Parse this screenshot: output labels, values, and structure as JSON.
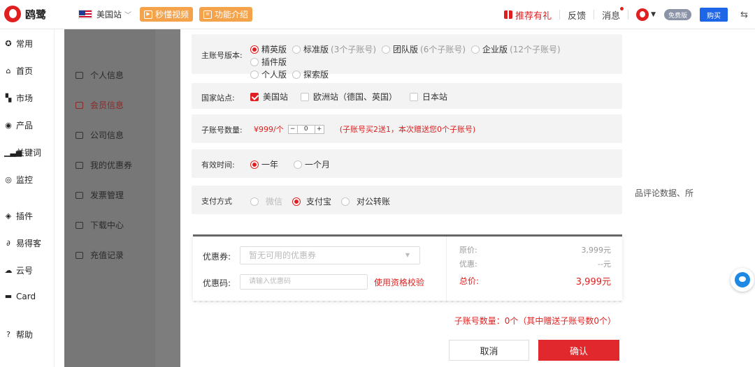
{
  "brand": {
    "name": "鸥鹭",
    "color": "#e02020"
  },
  "topbar": {
    "site": "美国站",
    "video_btn": "秒懂视频",
    "intro_btn": "功能介绍",
    "gift": "推荐有礼",
    "feedback": "反馈",
    "message": "消息",
    "plan_badge": "免费版",
    "buy": "购买"
  },
  "sidebar": {
    "items": [
      {
        "label": "常用",
        "icon": "star-icon"
      },
      {
        "label": "首页",
        "icon": "home-icon"
      },
      {
        "label": "市场",
        "icon": "market-icon"
      },
      {
        "label": "产品",
        "icon": "product-icon"
      },
      {
        "label": "关键词",
        "icon": "keyword-icon"
      },
      {
        "label": "监控",
        "icon": "monitor-icon"
      },
      {
        "label": "插件",
        "icon": "plugin-icon"
      },
      {
        "label": "易得客",
        "icon": "link-icon"
      },
      {
        "label": "云号",
        "icon": "cloud-icon"
      },
      {
        "label": "Card",
        "icon": "card-icon"
      },
      {
        "label": "帮助",
        "icon": "help-icon"
      }
    ]
  },
  "behind_menu": {
    "items": [
      "个人信息",
      "会员信息",
      "公司信息",
      "我的优惠券",
      "发票管理",
      "下载中心",
      "充值记录"
    ],
    "active_index": 1,
    "right_text": "品评论数据、所"
  },
  "modal": {
    "version": {
      "label": "主账号版本:",
      "options": [
        {
          "name": "精英版",
          "sub": "",
          "selected": true
        },
        {
          "name": "标准版",
          "sub": "(3个子账号)",
          "selected": false
        },
        {
          "name": "团队版",
          "sub": "(6个子账号)",
          "selected": false
        },
        {
          "name": "企业版",
          "sub": "(12个子账号)",
          "selected": false
        },
        {
          "name": "插件版",
          "sub": "",
          "selected": false
        },
        {
          "name": "个人版",
          "sub": "",
          "selected": false
        },
        {
          "name": "探索版",
          "sub": "",
          "selected": false
        }
      ]
    },
    "sites": {
      "label": "国家站点:",
      "options": [
        {
          "name": "美国站",
          "checked": true
        },
        {
          "name": "欧洲站（德国、英国）",
          "checked": false
        },
        {
          "name": "日本站",
          "checked": false
        }
      ]
    },
    "sub_accounts": {
      "label": "子账号数量:",
      "price": "¥999/个",
      "minus": "−",
      "value": "0",
      "plus": "+",
      "note": "(子账号买2送1，本次赠送您0个子账号)"
    },
    "duration": {
      "label": "有效时间:",
      "options": [
        {
          "name": "一年",
          "selected": true
        },
        {
          "name": "一个月",
          "selected": false
        }
      ]
    },
    "payment": {
      "label": "支付方式",
      "options": [
        {
          "name": "微信",
          "selected": false,
          "disabled": true
        },
        {
          "name": "支付宝",
          "selected": true,
          "disabled": false
        },
        {
          "name": "对公转账",
          "selected": false,
          "disabled": false
        }
      ]
    },
    "coupon": {
      "label": "优惠券:",
      "placeholder": "暂无可用的优惠券",
      "code_label": "优惠码:",
      "code_placeholder": "请输入优惠码",
      "verify": "使用资格校验"
    },
    "summary": {
      "original_label": "原价:",
      "original_value": "3,999元",
      "discount_label": "优惠:",
      "discount_value": "--元",
      "total_label": "总价:",
      "total_value": "3,999元"
    },
    "sub_count_text": "子账号数量：0个（其中赠送子账号数0个）",
    "cancel": "取消",
    "confirm": "确认"
  }
}
